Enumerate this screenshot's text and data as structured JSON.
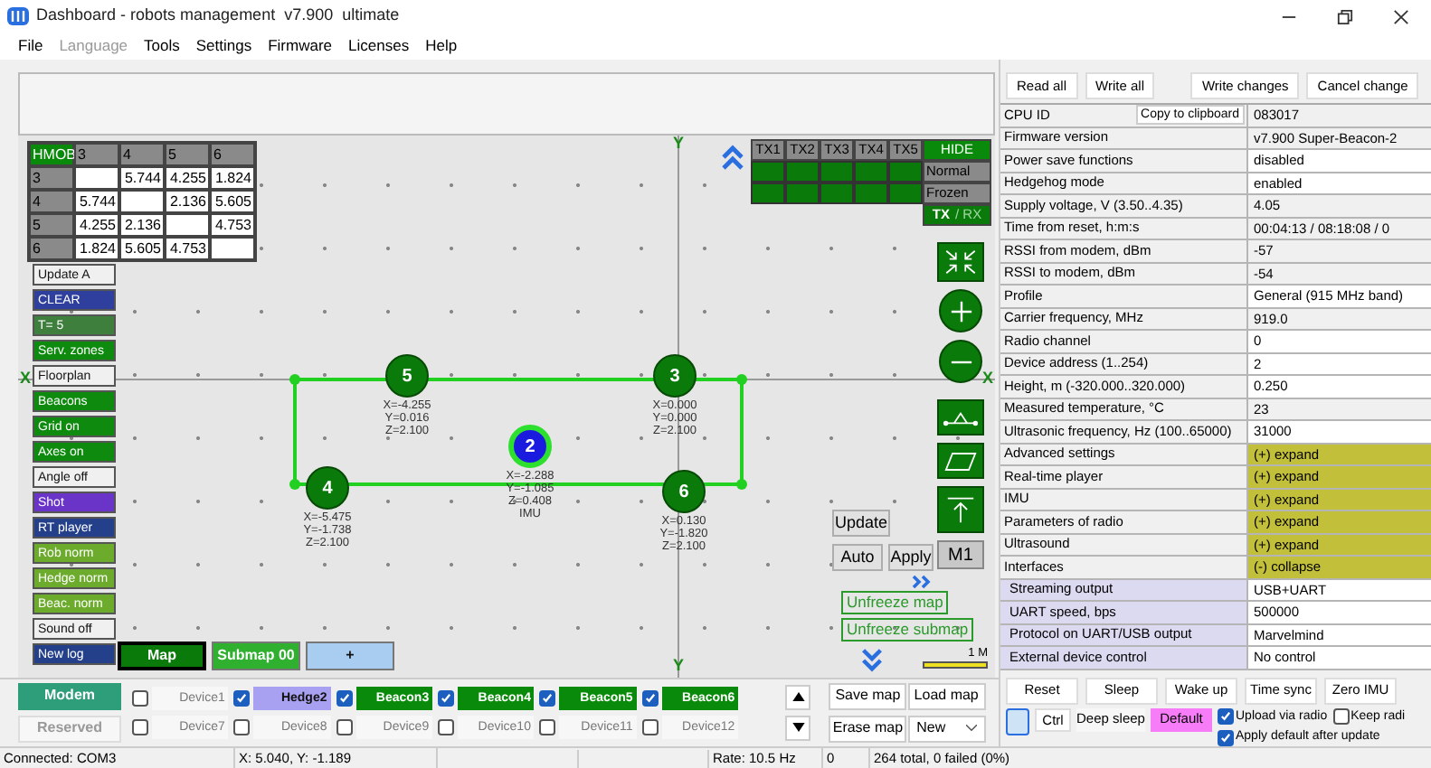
{
  "window": {
    "title": "Dashboard - robots management  v7.900  ultimate"
  },
  "menu": [
    {
      "label": "File",
      "disabled": false
    },
    {
      "label": "Language",
      "disabled": true
    },
    {
      "label": "Tools",
      "disabled": false
    },
    {
      "label": "Settings",
      "disabled": false
    },
    {
      "label": "Firmware",
      "disabled": false
    },
    {
      "label": "Licenses",
      "disabled": false
    },
    {
      "label": "Help",
      "disabled": false
    }
  ],
  "distance_table": {
    "corner": "HMOB",
    "columns": [
      "3",
      "4",
      "5",
      "6"
    ],
    "rows": [
      {
        "label": "3",
        "cells": [
          null,
          "5.744",
          "4.255",
          "1.824"
        ]
      },
      {
        "label": "4",
        "cells": [
          "5.744",
          null,
          "2.136",
          "5.605"
        ]
      },
      {
        "label": "5",
        "cells": [
          "4.255",
          "2.136",
          null,
          "4.753"
        ]
      },
      {
        "label": "6",
        "cells": [
          "1.824",
          "5.605",
          "4.753",
          null
        ]
      }
    ]
  },
  "left_buttons": [
    {
      "label": "Update A",
      "color": "#f0f0f0"
    },
    {
      "label": "CLEAR",
      "color": "#2e3f9e"
    },
    {
      "label": "T= 5",
      "color": "#3e7f3e"
    },
    {
      "label": "Serv. zones",
      "color": "#0e8a0e"
    },
    {
      "label": "Floorplan",
      "color": "#f0f0f0"
    },
    {
      "label": "Beacons",
      "color": "#0e8a0e"
    },
    {
      "label": "Grid on",
      "color": "#0e8a0e"
    },
    {
      "label": "Axes on",
      "color": "#0e8a0e"
    },
    {
      "label": "Angle off",
      "color": "#f0f0f0"
    },
    {
      "label": "Shot",
      "color": "#6a34c8"
    },
    {
      "label": "RT player",
      "color": "#24408a"
    },
    {
      "label": "Rob norm",
      "color": "#6cab2c"
    },
    {
      "label": "Hedge norm",
      "color": "#6cab2c"
    },
    {
      "label": "Beac. norm",
      "color": "#6cab2c"
    },
    {
      "label": "Sound off",
      "color": "#f0f0f0"
    },
    {
      "label": "New log",
      "color": "#24408a"
    }
  ],
  "axes": {
    "y_top": "Y",
    "x_left": "X",
    "x_right": "X",
    "y_bottom": "Y"
  },
  "nodes": [
    {
      "kind": "beacon",
      "id": "5",
      "coords": [
        "X=-4.255",
        "Y=0.016",
        "Z=2.100"
      ]
    },
    {
      "kind": "beacon",
      "id": "3",
      "coords": [
        "X=0.000",
        "Y=0.000",
        "Z=2.100"
      ]
    },
    {
      "kind": "beacon",
      "id": "4",
      "coords": [
        "X=-5.475",
        "Y=-1.738",
        "Z=2.100"
      ]
    },
    {
      "kind": "beacon",
      "id": "6",
      "coords": [
        "X=0.130",
        "Y=-1.820",
        "Z=2.100"
      ]
    },
    {
      "kind": "hedge",
      "id": "2",
      "coords": [
        "X=-2.288",
        "Y=-1.085",
        "Z=0.408"
      ],
      "note": "IMU"
    }
  ],
  "tx_panel": {
    "columns": [
      "TX1",
      "TX2",
      "TX3",
      "TX4",
      "TX5"
    ],
    "hide": "HIDE",
    "states": [
      "Normal",
      "Frozen"
    ],
    "mode": [
      {
        "label": "TX",
        "selected": true
      },
      {
        "label": "/ RX",
        "selected": false
      }
    ]
  },
  "map_controls": {
    "update": "Update",
    "auto": "Auto",
    "apply": "Apply",
    "marker": "M1",
    "unfreeze_map": "Unfreeze map",
    "unfreeze_submap": "Unfreeze submap",
    "scale": "1 M"
  },
  "map_tabs": [
    {
      "label": "Map",
      "selected": true,
      "color": "#0a7a0a"
    },
    {
      "label": "Submap 00",
      "selected": false,
      "color": "#2fb02f"
    },
    {
      "label": "+",
      "selected": false,
      "color": "#a9cdf0"
    }
  ],
  "connection_tabs": [
    {
      "label": "Modem",
      "selected": true
    },
    {
      "label": "Reserved",
      "selected": false
    }
  ],
  "devices": [
    {
      "label": "Device1",
      "checked": false
    },
    {
      "label": "Hedge2",
      "checked": true,
      "color": "#a8a0f0"
    },
    {
      "label": "Beacon3",
      "checked": true,
      "color": "#0a8a0a"
    },
    {
      "label": "Beacon4",
      "checked": true,
      "color": "#0a8a0a"
    },
    {
      "label": "Beacon5",
      "checked": true,
      "color": "#0a8a0a"
    },
    {
      "label": "Beacon6",
      "checked": true,
      "color": "#0a8a0a"
    },
    {
      "label": "Device7",
      "checked": false
    },
    {
      "label": "Device8",
      "checked": false
    },
    {
      "label": "Device9",
      "checked": false
    },
    {
      "label": "Device10",
      "checked": false
    },
    {
      "label": "Device11",
      "checked": false
    },
    {
      "label": "Device12",
      "checked": false
    }
  ],
  "map_file": {
    "save": "Save map",
    "load": "Load map",
    "erase": "Erase map",
    "select": "New"
  },
  "settings": {
    "actions": [
      "Read all",
      "Write all",
      "Write changes",
      "Cancel change"
    ],
    "copy_button": "Copy to clipboard",
    "rows": [
      {
        "kind": "copy",
        "label": "CPU ID",
        "value": "083017",
        "editable": false
      },
      {
        "kind": "field",
        "label": "Firmware version",
        "value": "v7.900 Super-Beacon-2",
        "editable": false
      },
      {
        "kind": "field",
        "label": "Power save functions",
        "value": "disabled",
        "editable": true
      },
      {
        "kind": "field",
        "label": "Hedgehog mode",
        "value": "enabled",
        "editable": true
      },
      {
        "kind": "field",
        "label": "Supply voltage, V (3.50..4.35)",
        "value": "4.05",
        "editable": false
      },
      {
        "kind": "field",
        "label": "Time from reset, h:m:s",
        "value": "00:04:13 / 08:18:08 / 0",
        "editable": false
      },
      {
        "kind": "field",
        "label": "RSSI from modem, dBm",
        "value": "-57",
        "editable": false
      },
      {
        "kind": "field",
        "label": "RSSI to modem, dBm",
        "value": "-54",
        "editable": false
      },
      {
        "kind": "field",
        "label": "Profile",
        "value": "General (915 MHz band)",
        "editable": true
      },
      {
        "kind": "field",
        "label": "Carrier frequency, MHz",
        "value": "919.0",
        "editable": false
      },
      {
        "kind": "field",
        "label": "Radio channel",
        "value": "0",
        "editable": true
      },
      {
        "kind": "field",
        "label": "Device address (1..254)",
        "value": "2",
        "editable": true
      },
      {
        "kind": "field",
        "label": "Height, m (-320.000..320.000)",
        "value": "0.250",
        "editable": true
      },
      {
        "kind": "field",
        "label": "Measured temperature, °C",
        "value": "23",
        "editable": false
      },
      {
        "kind": "field",
        "label": "Ultrasonic frequency, Hz (100..65000)",
        "value": "31000",
        "editable": true
      },
      {
        "kind": "section",
        "label": "Advanced settings",
        "value": "(+) expand"
      },
      {
        "kind": "section",
        "label": "Real-time player",
        "value": "(+) expand"
      },
      {
        "kind": "section",
        "label": "IMU",
        "value": "(+) expand"
      },
      {
        "kind": "section",
        "label": "Parameters of radio",
        "value": "(+) expand"
      },
      {
        "kind": "section",
        "label": "Ultrasound",
        "value": "(+) expand"
      },
      {
        "kind": "section",
        "label": "Interfaces",
        "value": "(-) collapse"
      },
      {
        "kind": "sub",
        "label": "Streaming output",
        "value": "USB+UART"
      },
      {
        "kind": "sub",
        "label": "UART speed, bps",
        "value": "500000"
      },
      {
        "kind": "sub",
        "label": "Protocol on UART/USB output",
        "value": "Marvelmind"
      },
      {
        "kind": "sub",
        "label": "External device control",
        "value": "No control"
      }
    ]
  },
  "device_actions": {
    "buttons": [
      "Reset",
      "Sleep",
      "Wake up",
      "Time sync",
      "Zero IMU"
    ],
    "ctrl": "Ctrl",
    "deep_sleep": "Deep sleep",
    "default": "Default",
    "options": [
      {
        "label": "Upload via radio",
        "checked": true
      },
      {
        "label": "Keep radi",
        "checked": false
      },
      {
        "label": "Apply default after update",
        "checked": true
      }
    ]
  },
  "status_bar": {
    "connection": "Connected: COM3",
    "position": "X: 5.040, Y: -1.189",
    "rate": "Rate: 10.5 Hz",
    "count": "0",
    "summary": "264 total, 0 failed (0%)"
  }
}
